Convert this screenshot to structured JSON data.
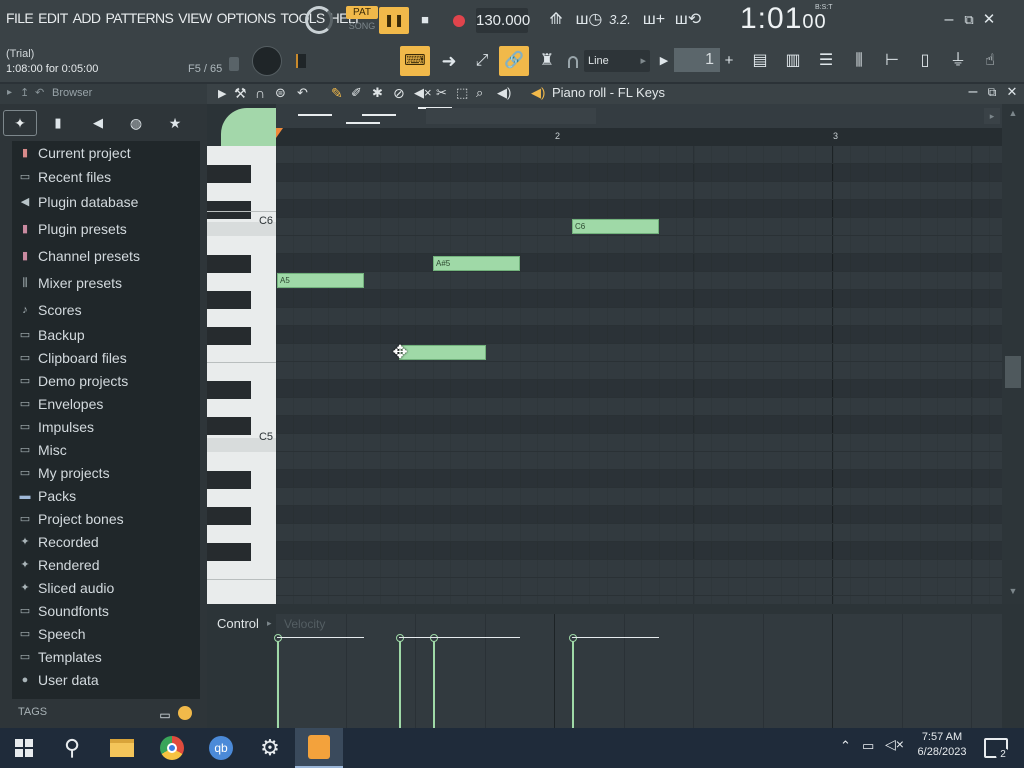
{
  "menu": [
    "FILE",
    "EDIT",
    "ADD",
    "PATTERNS",
    "VIEW",
    "OPTIONS",
    "TOOLS",
    "HELP"
  ],
  "transport": {
    "pat_label": "PAT",
    "song_label": "SONG",
    "tempo": "130.000",
    "time_main": "1:01",
    "time_sub": "00",
    "time_unit": "B:S:T"
  },
  "hint": {
    "line1": "(Trial)",
    "line2": "1:08:00 for 0:05:00",
    "line3": "F5 / 65"
  },
  "snap": {
    "tool_label": "Line",
    "pattern_number": "1"
  },
  "browser": {
    "title": "Browser",
    "items": [
      {
        "label": "Current project",
        "icon": "project-icon"
      },
      {
        "label": "Recent files",
        "icon": "folder-icon"
      },
      {
        "label": "Plugin database",
        "icon": "plugin-icon"
      },
      {
        "label": "Plugin presets",
        "icon": "preset-icon"
      },
      {
        "label": "Channel presets",
        "icon": "preset-icon"
      },
      {
        "label": "Mixer presets",
        "icon": "mixer-icon"
      },
      {
        "label": "Scores",
        "icon": "score-icon"
      },
      {
        "label": "Backup",
        "icon": "folder-icon"
      },
      {
        "label": "Clipboard files",
        "icon": "folder-icon"
      },
      {
        "label": "Demo projects",
        "icon": "folder-icon"
      },
      {
        "label": "Envelopes",
        "icon": "folder-icon"
      },
      {
        "label": "Impulses",
        "icon": "folder-icon"
      },
      {
        "label": "Misc",
        "icon": "folder-icon"
      },
      {
        "label": "My projects",
        "icon": "folder-icon"
      },
      {
        "label": "Packs",
        "icon": "packs-icon"
      },
      {
        "label": "Project bones",
        "icon": "folder-icon"
      },
      {
        "label": "Recorded",
        "icon": "recorded-icon"
      },
      {
        "label": "Rendered",
        "icon": "rendered-icon"
      },
      {
        "label": "Sliced audio",
        "icon": "sliced-icon"
      },
      {
        "label": "Soundfonts",
        "icon": "folder-icon"
      },
      {
        "label": "Speech",
        "icon": "folder-icon"
      },
      {
        "label": "Templates",
        "icon": "folder-icon"
      },
      {
        "label": "User data",
        "icon": "user-icon"
      }
    ],
    "tags_label": "TAGS"
  },
  "piano_roll": {
    "title": "Piano roll - FL Keys",
    "bar_numbers": [
      "2",
      "3"
    ],
    "key_labels": [
      "C6",
      "C5"
    ],
    "notes": [
      {
        "label": "A5",
        "start_beat": 0,
        "length_beats": 1.25,
        "pitch": "A5"
      },
      {
        "label": "A#5",
        "start_beat": 2.25,
        "length_beats": 1.25,
        "pitch": "A#5"
      },
      {
        "label": "C6",
        "start_beat": 4.25,
        "length_beats": 1.25,
        "pitch": "C6"
      },
      {
        "label": "",
        "start_beat": 1.75,
        "length_beats": 1.25,
        "pitch": "F5"
      }
    ],
    "control_label": "Control",
    "control_param": "Velocity"
  },
  "taskbar": {
    "time": "7:57 AM",
    "date": "6/28/2023",
    "notification_count": "2"
  },
  "colors": {
    "accent": "#f1b94a",
    "note": "#9fd9a7",
    "background": "#323a3f"
  }
}
